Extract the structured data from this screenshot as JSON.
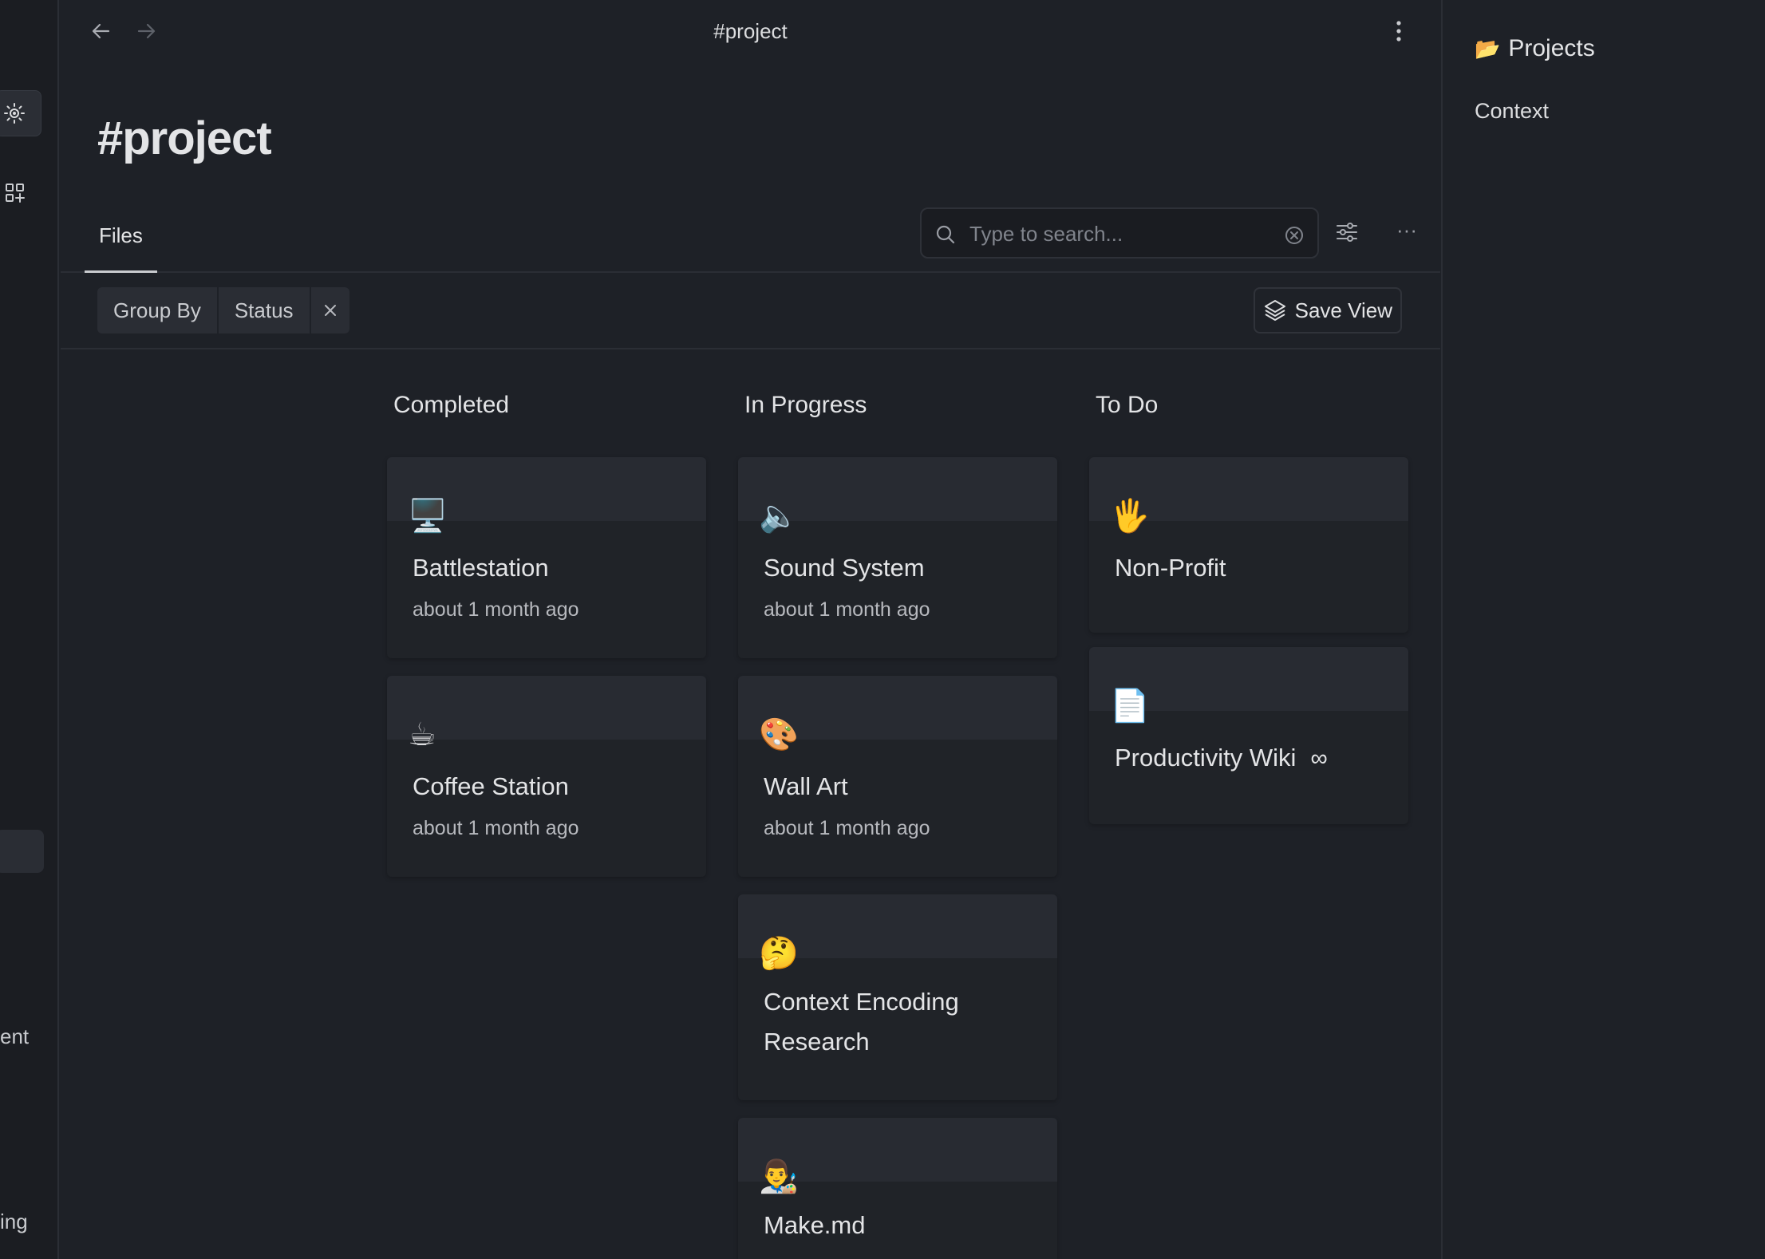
{
  "window": {
    "title": "#project"
  },
  "page": {
    "title": "#project"
  },
  "tabs": [
    {
      "label": "Files"
    }
  ],
  "search": {
    "placeholder": "Type to search...",
    "value": ""
  },
  "filters": {
    "group_by_label": "Group By",
    "group_by_value": "Status",
    "save_view_label": "Save View"
  },
  "ribbon": {
    "partial_texts": [
      "ent",
      "ing"
    ]
  },
  "board": {
    "columns": [
      {
        "title": "Completed",
        "cards": [
          {
            "emoji": "🖥️",
            "title": "Battlestation",
            "subtitle": "about 1 month ago"
          },
          {
            "emoji": "☕",
            "title": "Coffee Station",
            "subtitle": "about 1 month ago"
          }
        ]
      },
      {
        "title": "In Progress",
        "cards": [
          {
            "emoji": "🔈",
            "title": "Sound System",
            "subtitle": "about 1 month ago"
          },
          {
            "emoji": "🎨",
            "title": "Wall Art",
            "subtitle": "about 1 month ago"
          },
          {
            "emoji": "🤔",
            "title_line1": "Context Encoding",
            "title_line2": "Research",
            "subtitle": ""
          },
          {
            "emoji": "👨‍🎨",
            "title": "Make.md",
            "subtitle": ""
          }
        ]
      },
      {
        "title": "To Do",
        "cards": [
          {
            "emoji": "🖐️",
            "title": "Non-Profit",
            "subtitle": ""
          },
          {
            "emoji": "📄",
            "title": "Productivity Wiki",
            "link_glyph": "∞",
            "subtitle": ""
          }
        ]
      }
    ]
  },
  "right_sidebar": {
    "folder_emoji": "📂",
    "title": "Projects",
    "items": [
      {
        "label": "Context"
      }
    ]
  }
}
